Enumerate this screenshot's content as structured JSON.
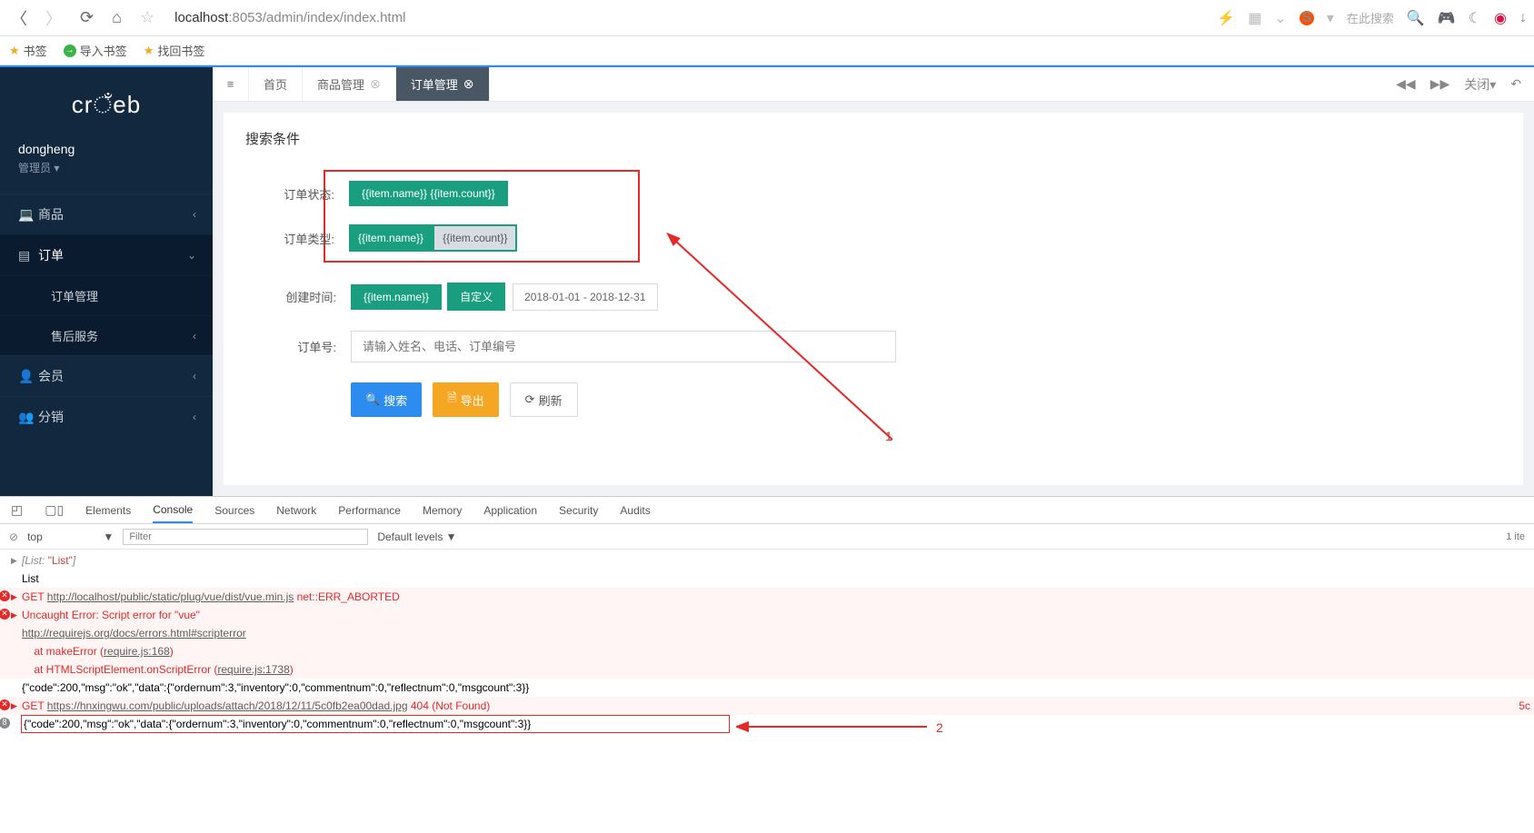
{
  "browser": {
    "url_host": "localhost",
    "url_port_path": ":8053/admin/index/index.html",
    "search_placeholder": "在此搜索",
    "sogou_mark": "S"
  },
  "bookmarks": {
    "bookmarks_label": "书签",
    "import_label": "导入书签",
    "find_label": "找回书签"
  },
  "sidebar": {
    "logo_text": "crmeb",
    "username": "dongheng",
    "role": "管理员",
    "menu": {
      "goods": "商品",
      "order": "订单",
      "order_manage": "订单管理",
      "after_sales": "售后服务",
      "member": "会员",
      "distribution": "分销"
    }
  },
  "tabs": {
    "home": "首页",
    "goods_manage": "商品管理",
    "order_manage": "订单管理",
    "close_label": "关闭"
  },
  "search_panel": {
    "title": "搜索条件",
    "row1_label": "订单状态:",
    "row1_btn": "{{item.name}} {{item.count}}",
    "row2_label": "订单类型:",
    "row2_btn_a": "{{item.name}}",
    "row2_btn_b": "{{item.count}}",
    "row3_label": "创建时间:",
    "row3_btn": "{{item.name}}",
    "row3_custom": "自定义",
    "row3_date": "2018-01-01 - 2018-12-31",
    "row4_label": "订单号:",
    "row4_placeholder": "请输入姓名、电话、订单编号",
    "btn_search": "搜索",
    "btn_export": "导出",
    "btn_refresh": "刷新"
  },
  "annotations": {
    "one": "1",
    "two": "2"
  },
  "devtools": {
    "tabs": {
      "elements": "Elements",
      "console": "Console",
      "sources": "Sources",
      "network": "Network",
      "performance": "Performance",
      "memory": "Memory",
      "application": "Application",
      "security": "Security",
      "audits": "Audits"
    },
    "top": "top",
    "filter_placeholder": "Filter",
    "levels": "Default levels ▼",
    "right_count": "1 ite",
    "log1a": "[List: ",
    "log1b": "\"List\"",
    "log1c": "]",
    "log2": "List",
    "log3a": "GET ",
    "log3b": "http://localhost/public/static/plug/vue/dist/vue.min.js",
    "log3c": " net::ERR_ABORTED",
    "log4a": "Uncaught Error: Script error for \"vue\"",
    "log4b": "http://requirejs.org/docs/errors.html#scripterror",
    "log4c": "    at makeError (",
    "log4c_link": "require.js:168",
    "log4c_end": ")",
    "log4d": "    at HTMLScriptElement.onScriptError (",
    "log4d_link": "require.js:1738",
    "log4d_end": ")",
    "log5": "{\"code\":200,\"msg\":\"ok\",\"data\":{\"ordernum\":3,\"inventory\":0,\"commentnum\":0,\"reflectnum\":0,\"msgcount\":3}}",
    "log6a": "GET ",
    "log6b": "https://hnxingwu.com/public/uploads/attach/2018/12/11/5c0fb2ea00dad.jpg",
    "log6c": " 404 (Not Found)",
    "log6_right": "5c",
    "log7_count": "8",
    "log7": "{\"code\":200,\"msg\":\"ok\",\"data\":{\"ordernum\":3,\"inventory\":0,\"commentnum\":0,\"reflectnum\":0,\"msgcount\":3}}"
  }
}
